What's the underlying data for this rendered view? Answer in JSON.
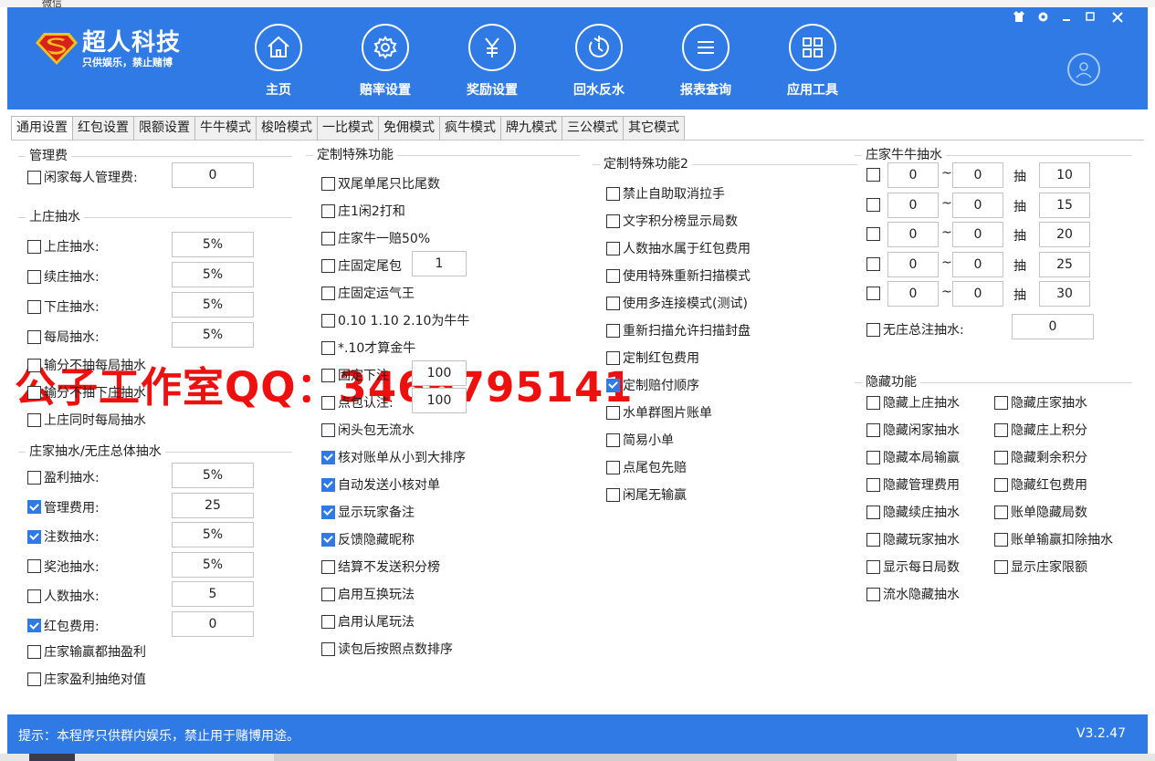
{
  "peek_title": "微信",
  "header": {
    "brand_name": "超人科技",
    "brand_slogan": "只供娱乐，禁止赌博",
    "nav": [
      {
        "label": "主页",
        "icon": "home-icon"
      },
      {
        "label": "赔率设置",
        "icon": "gear-icon"
      },
      {
        "label": "奖励设置",
        "icon": "yen-icon"
      },
      {
        "label": "回水反水",
        "icon": "refresh-clock-icon"
      },
      {
        "label": "报表查询",
        "icon": "list-icon"
      },
      {
        "label": "应用工具",
        "icon": "grid-icon"
      }
    ],
    "window_controls": [
      "skin-icon",
      "settings-icon",
      "minimize-icon",
      "maximize-icon",
      "close-icon"
    ]
  },
  "tabs": [
    "通用设置",
    "红包设置",
    "限额设置",
    "牛牛模式",
    "梭哈模式",
    "一比模式",
    "免佣模式",
    "疯牛模式",
    "牌九模式",
    "三公模式",
    "其它模式"
  ],
  "groups": {
    "mgmt": {
      "title": "管理费",
      "items": [
        {
          "label": "闲家每人管理费:",
          "checked": false,
          "value": "0"
        }
      ]
    },
    "shang": {
      "title": "上庄抽水",
      "items": [
        {
          "label": "上庄抽水:",
          "checked": false,
          "value": "5%"
        },
        {
          "label": "续庄抽水:",
          "checked": false,
          "value": "5%"
        },
        {
          "label": "下庄抽水:",
          "checked": false,
          "value": "5%"
        },
        {
          "label": "每局抽水:",
          "checked": false,
          "value": "5%"
        }
      ],
      "extras": [
        {
          "label": "输分不抽每局抽水",
          "checked": false
        },
        {
          "label": "输分不抽下庄抽水",
          "checked": false
        },
        {
          "label": "上庄同时每局抽水",
          "checked": false
        }
      ]
    },
    "zhuang": {
      "title": "庄家抽水/无庄总体抽水",
      "items": [
        {
          "label": "盈利抽水:",
          "checked": false,
          "value": "5%"
        },
        {
          "label": "管理费用:",
          "checked": true,
          "value": "25"
        },
        {
          "label": "注数抽水:",
          "checked": true,
          "value": "5%"
        },
        {
          "label": "奖池抽水:",
          "checked": false,
          "value": "5%"
        },
        {
          "label": "人数抽水:",
          "checked": false,
          "value": "5"
        },
        {
          "label": "红包费用:",
          "checked": true,
          "value": "0"
        }
      ],
      "extras": [
        {
          "label": "庄家输赢都抽盈利",
          "checked": false
        },
        {
          "label": "庄家盈利抽绝对值",
          "checked": false
        }
      ]
    },
    "custom1": {
      "title": "定制特殊功能",
      "items": [
        {
          "label": "双尾单尾只比尾数",
          "checked": false
        },
        {
          "label": "庄1闲2打和",
          "checked": false
        },
        {
          "label": "庄家牛一赔50%",
          "checked": false
        },
        {
          "label": "庄固定尾包",
          "checked": false,
          "value": "1"
        },
        {
          "label": "庄固定运气王",
          "checked": false
        },
        {
          "label": "0.10 1.10 2.10为牛牛",
          "checked": false
        },
        {
          "label": "*.10才算金牛",
          "checked": false
        },
        {
          "label": "固定下注",
          "checked": false,
          "value": "100"
        },
        {
          "label": "点包认注:",
          "checked": false,
          "value": "100"
        },
        {
          "label": "闲头包无流水",
          "checked": false
        },
        {
          "label": "核对账单从小到大排序",
          "checked": true
        },
        {
          "label": "自动发送小核对单",
          "checked": true
        },
        {
          "label": "显示玩家备注",
          "checked": true
        },
        {
          "label": "反馈隐藏昵称",
          "checked": true
        },
        {
          "label": "结算不发送积分榜",
          "checked": false
        },
        {
          "label": "启用互换玩法",
          "checked": false
        },
        {
          "label": "启用认尾玩法",
          "checked": false
        },
        {
          "label": "读包后按照点数排序",
          "checked": false
        }
      ]
    },
    "custom2": {
      "title": "定制特殊功能2",
      "items": [
        {
          "label": "禁止自助取消拉手",
          "checked": false
        },
        {
          "label": "文字积分榜显示局数",
          "checked": false
        },
        {
          "label": "人数抽水属于红包费用",
          "checked": false
        },
        {
          "label": "使用特殊重新扫描模式",
          "checked": false
        },
        {
          "label": "使用多连接模式(测试)",
          "checked": false
        },
        {
          "label": "重新扫描允许扫描封盘",
          "checked": false
        },
        {
          "label": "定制红包费用",
          "checked": false
        },
        {
          "label": "定制赔付顺序",
          "checked": true
        },
        {
          "label": "水单群图片账单",
          "checked": false
        },
        {
          "label": "简易小单",
          "checked": false
        },
        {
          "label": "点尾包先赔",
          "checked": false
        },
        {
          "label": "闲尾无输赢",
          "checked": false
        }
      ]
    },
    "niuniu": {
      "title": "庄家牛牛抽水",
      "tilde": "~",
      "chou": "抽",
      "rows": [
        {
          "checked": false,
          "from": "0",
          "to": "0",
          "rate": "10"
        },
        {
          "checked": false,
          "from": "0",
          "to": "0",
          "rate": "15"
        },
        {
          "checked": false,
          "from": "0",
          "to": "0",
          "rate": "20"
        },
        {
          "checked": false,
          "from": "0",
          "to": "0",
          "rate": "25"
        },
        {
          "checked": false,
          "from": "0",
          "to": "0",
          "rate": "30"
        }
      ],
      "nozhuang": {
        "label": "无庄总注抽水:",
        "checked": false,
        "value": "0"
      }
    },
    "hide": {
      "title": "隐藏功能",
      "left": [
        {
          "label": "隐藏上庄抽水",
          "checked": false
        },
        {
          "label": "隐藏闲家抽水",
          "checked": false
        },
        {
          "label": "隐藏本局输赢",
          "checked": false
        },
        {
          "label": "隐藏管理费用",
          "checked": false
        },
        {
          "label": "隐藏续庄抽水",
          "checked": false
        },
        {
          "label": "隐藏玩家抽水",
          "checked": false
        },
        {
          "label": "显示每日局数",
          "checked": false
        },
        {
          "label": "流水隐藏抽水",
          "checked": false
        }
      ],
      "right": [
        {
          "label": "隐藏庄家抽水",
          "checked": false
        },
        {
          "label": "隐藏庄上积分",
          "checked": false
        },
        {
          "label": "隐藏剩余积分",
          "checked": false
        },
        {
          "label": "隐藏红包费用",
          "checked": false
        },
        {
          "label": "账单隐藏局数",
          "checked": false
        },
        {
          "label": "账单输赢扣除抽水",
          "checked": false
        },
        {
          "label": "显示庄家限额",
          "checked": false
        }
      ]
    }
  },
  "watermark": "公子工作室QQ：3466795141",
  "footer": {
    "tip": "提示：本程序只供群内娱乐，禁止用于赌博用途。",
    "version": "V3.2.47"
  },
  "colors": {
    "accent": "#2f7ae5",
    "watermark": "#ee0f0f"
  }
}
